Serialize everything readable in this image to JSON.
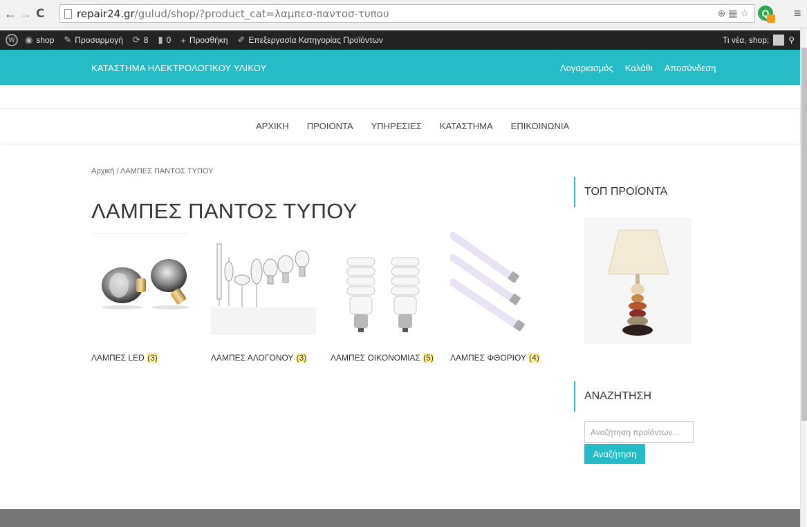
{
  "browser": {
    "back": "←",
    "forward": "→",
    "reload": "C",
    "url_host": "repair24.gr",
    "url_path": "/gulud/shop/?product_cat=λαμπεσ-παντοσ-τυπου",
    "menu": "≡"
  },
  "admin_bar": {
    "site": "shop",
    "customize": "Προσαρμογή",
    "updates": "8",
    "comments": "0",
    "new": "Προσθήκη",
    "edit": "Επεξεργασία Κατηγορίας Προϊόντων",
    "greeting": "Τι νέα, shop;"
  },
  "header": {
    "store_name": "ΚΑΤΑΣΤΗΜΑ ΗΛΕΚΤΡΟΛΟΓΙΚΟΥ ΥΛΙΚΟΥ",
    "links": [
      "Λογαριασμός",
      "Καλάθι",
      "Αποσύνδεση"
    ]
  },
  "nav": [
    "ΑΡΧΙΚΗ",
    "ΠΡΟΙΟΝΤΑ",
    "ΥΠΗΡΕΣΙΕΣ",
    "ΚΑΤΑΣΤΗΜΑ",
    "ΕΠΙΚΟΙΝΩΝΙΑ"
  ],
  "breadcrumb": "Αρχική / ΛΑΜΠΕΣ ΠΑΝΤΟΣ ΤΥΠΟΥ",
  "page_title": "ΛΑΜΠΕΣ ΠΑΝΤΟΣ ΤΥΠΟΥ",
  "categories": [
    {
      "name": "ΛΑΜΠΕΣ LED",
      "count": "(3)"
    },
    {
      "name": "ΛΑΜΠΕΣ ΑΛΟΓΟΝΟΥ",
      "count": "(3)"
    },
    {
      "name": "ΛΑΜΠΕΣ ΟΙΚΟΝΟΜΙΑΣ",
      "count": "(5)"
    },
    {
      "name": "ΛΑΜΠΕΣ ΦΘΟΡΙΟΥ",
      "count": "(4)"
    }
  ],
  "sidebar": {
    "top_products_title": "ΤΟΠ ΠΡΟΪΟΝΤΑ",
    "search_title": "ΑΝΑΖΗΤΗΣΗ",
    "search_placeholder": "Αναζήτηση προϊόντων...",
    "search_button": "Αναζήτηση"
  },
  "colors": {
    "accent": "#25bcc7",
    "admin_bar": "#232323",
    "count_highlight": "#fff4a3",
    "footer": "#777777"
  }
}
